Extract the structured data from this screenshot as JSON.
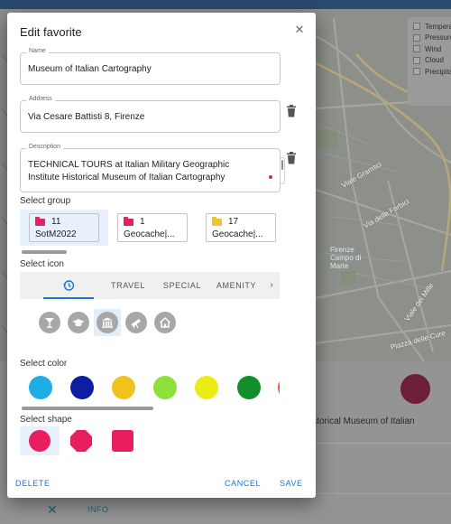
{
  "map": {
    "labels": [
      "Firenze",
      "Campo di Marte",
      "Viale Gramsci",
      "Via delle Forbici",
      "Viale dei Mille",
      "Piazza delle Cure"
    ],
    "layers": [
      "Temperature",
      "Pressure",
      "Wind",
      "Cloud",
      "Precipitation"
    ],
    "background_description": "istorical Museum of Italian",
    "background_actions": {
      "close_icon": "close-icon",
      "info_label": "INFO"
    }
  },
  "dialog": {
    "title": "Edit favorite",
    "close_icon": "close-icon",
    "name": {
      "label": "Name",
      "value": "Museum of Italian Cartography"
    },
    "address": {
      "label": "Address",
      "value": "Via Cesare Battisti 8, Firenze"
    },
    "description": {
      "label": "Description",
      "value": "TECHNICAL TOURS at Italian Military Geographic Institute Historical Museum of Italian Cartography"
    },
    "select_group_label": "Select group",
    "groups": [
      {
        "count": "11",
        "name": "SotM2022",
        "color": "#e0245e",
        "selected": true
      },
      {
        "count": "1",
        "name": "Geocache|...",
        "color": "#e0245e",
        "selected": false
      },
      {
        "count": "17",
        "name": "Geocache|...",
        "color": "#f2c230",
        "selected": false
      }
    ],
    "select_icon_label": "Select icon",
    "icon_tabs": [
      {
        "label": "",
        "icon": "history-icon",
        "active": true
      },
      {
        "label": "TRAVEL",
        "active": false
      },
      {
        "label": "SPECIAL",
        "active": false
      },
      {
        "label": "AMENITY",
        "active": false
      }
    ],
    "icons": [
      "cocktail-icon",
      "graduation-cap-icon",
      "museum-icon",
      "telescope-icon",
      "house-icon"
    ],
    "select_color_label": "Select color",
    "colors": [
      "#1eaee5",
      "#0d1ea1",
      "#f0c31c",
      "#8ee03a",
      "#eeea15",
      "#118f2a",
      "#f4563c"
    ],
    "select_shape_label": "Select shape",
    "shapes": [
      "circle",
      "octagon",
      "square"
    ],
    "actions": {
      "delete": "DELETE",
      "cancel": "CANCEL",
      "save": "SAVE"
    }
  }
}
